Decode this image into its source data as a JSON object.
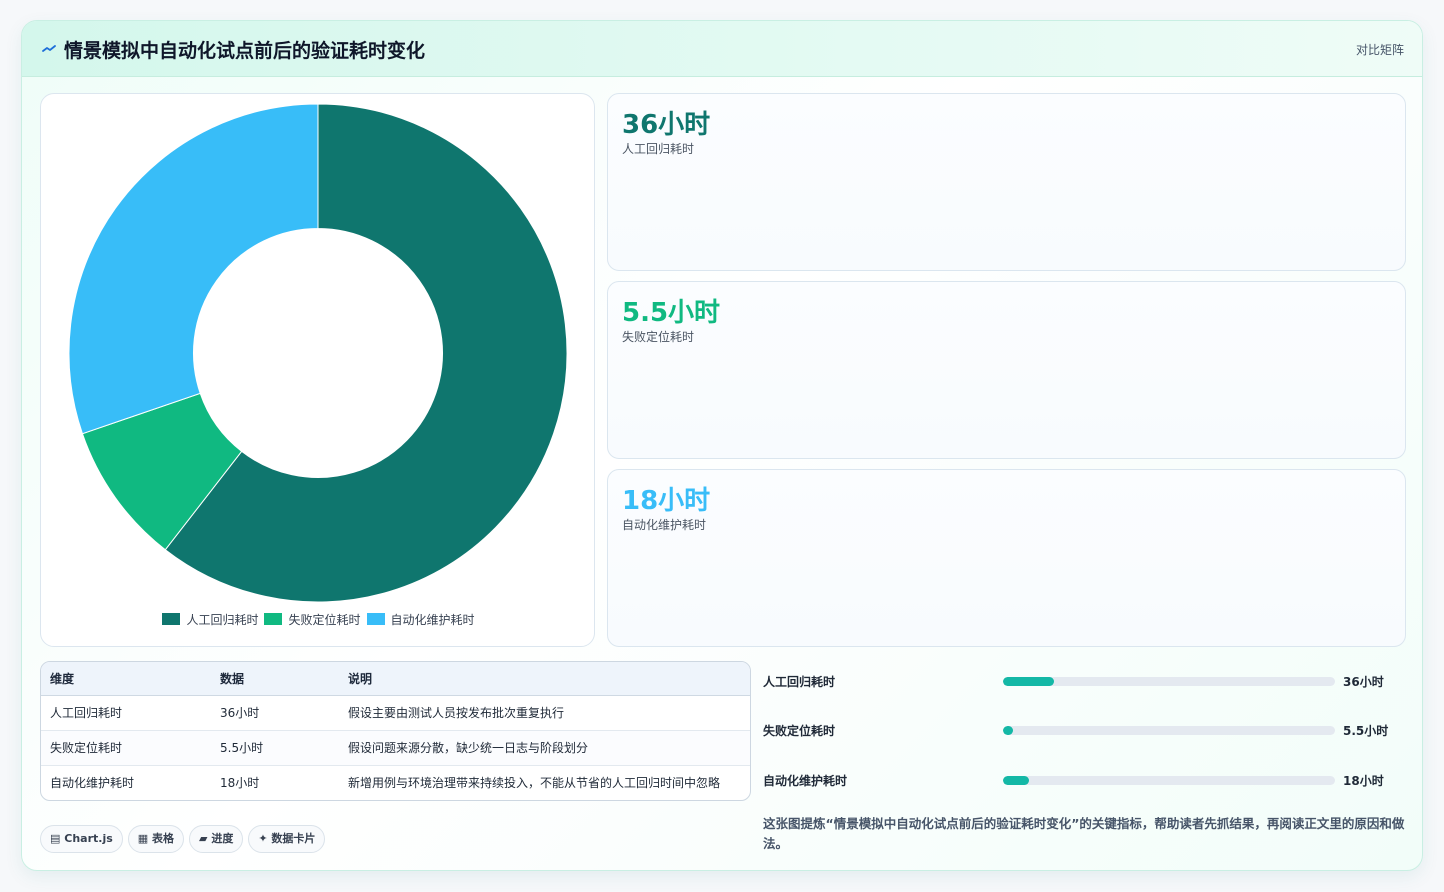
{
  "header": {
    "title": "情景模拟中自动化试点前后的验证耗时变化",
    "tag": "对比矩阵",
    "icon": "trend-line-icon"
  },
  "chart_data": {
    "type": "pie",
    "categories": [
      "人工回归耗时",
      "失败定位耗时",
      "自动化维护耗时"
    ],
    "values": [
      36,
      5.5,
      18
    ],
    "colors": [
      "#0f766e",
      "#10b981",
      "#38bdf8"
    ],
    "legend_position": "bottom",
    "inner_radius_ratio": 0.5
  },
  "kpis": [
    {
      "value": "36小时",
      "label": "人工回归耗时",
      "color": "#0f766e"
    },
    {
      "value": "5.5小时",
      "label": "失败定位耗时",
      "color": "#10b981"
    },
    {
      "value": "18小时",
      "label": "自动化维护耗时",
      "color": "#38bdf8"
    }
  ],
  "table": {
    "headers": [
      "维度",
      "数据",
      "说明"
    ],
    "rows": [
      [
        "人工回归耗时",
        "36小时",
        "假设主要由测试人员按发布批次重复执行"
      ],
      [
        "失败定位耗时",
        "5.5小时",
        "假设问题来源分散，缺少统一日志与阶段划分"
      ],
      [
        "自动化维护耗时",
        "18小时",
        "新增用例与环境治理带来持续投入，不能从节省的人工回归时间中忽略"
      ]
    ]
  },
  "progress": [
    {
      "label": "人工回归耗时",
      "value": "36小时",
      "fraction": 0.155
    },
    {
      "label": "失败定位耗时",
      "value": "5.5小时",
      "fraction": 0.03
    },
    {
      "label": "自动化维护耗时",
      "value": "18小时",
      "fraction": 0.078
    }
  ],
  "chips": [
    {
      "icon": "▤",
      "label": "Chart.js"
    },
    {
      "icon": "▦",
      "label": "表格"
    },
    {
      "icon": "▰",
      "label": "进度"
    },
    {
      "icon": "✦",
      "label": "数据卡片"
    }
  ],
  "note": "这张图提炼“情景模拟中自动化试点前后的验证耗时变化”的关键指标，帮助读者先抓结果，再阅读正文里的原因和做法。"
}
